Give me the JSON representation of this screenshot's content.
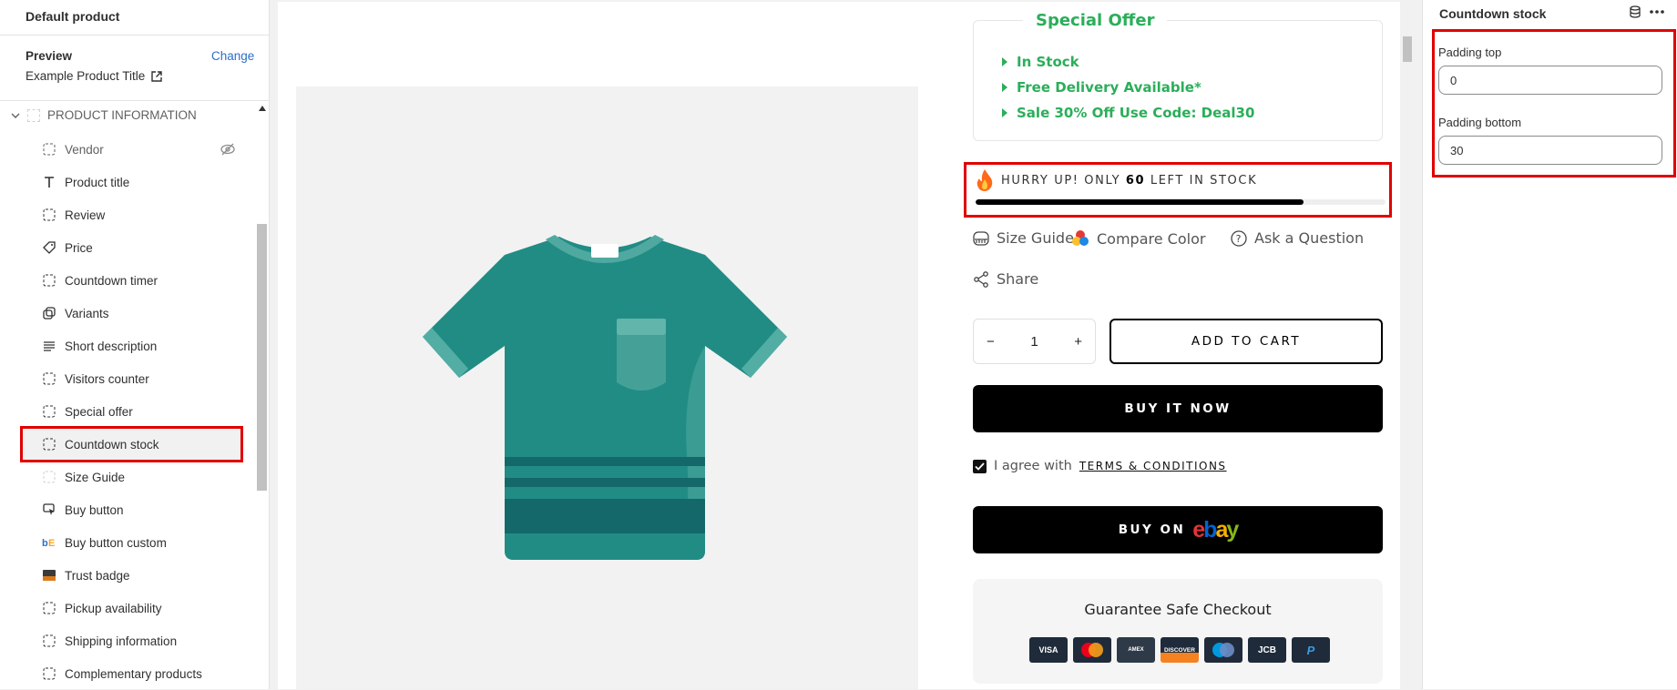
{
  "sidebar": {
    "header": "Default product",
    "preview_label": "Preview",
    "change_label": "Change",
    "preview_product": "Example Product Title",
    "section_title": "PRODUCT INFORMATION",
    "items": [
      {
        "label": "Vendor",
        "icon": "dashed-block-icon",
        "hidden": true
      },
      {
        "label": "Product title",
        "icon": "text-icon"
      },
      {
        "label": "Review",
        "icon": "dashed-block-icon"
      },
      {
        "label": "Price",
        "icon": "tag-icon"
      },
      {
        "label": "Countdown timer",
        "icon": "dashed-block-icon"
      },
      {
        "label": "Variants",
        "icon": "variants-icon"
      },
      {
        "label": "Short description",
        "icon": "paragraph-icon"
      },
      {
        "label": "Visitors counter",
        "icon": "dashed-block-icon"
      },
      {
        "label": "Special offer",
        "icon": "dashed-block-icon"
      },
      {
        "label": "Countdown stock",
        "icon": "dashed-block-icon",
        "selected": true
      },
      {
        "label": "Size Guide",
        "icon": "faded-block-icon"
      },
      {
        "label": "Buy button",
        "icon": "cursor-icon"
      },
      {
        "label": "Buy button custom",
        "icon": "app-icon"
      },
      {
        "label": "Trust badge",
        "icon": "image-icon"
      },
      {
        "label": "Pickup availability",
        "icon": "dashed-block-icon"
      },
      {
        "label": "Shipping information",
        "icon": "dashed-block-icon"
      },
      {
        "label": "Complementary products",
        "icon": "dashed-block-icon"
      }
    ]
  },
  "product": {
    "offer_title": "Special Offer",
    "offer_items": [
      "In Stock",
      "Free Delivery Available*",
      "Sale 30% Off Use Code: Deal30"
    ],
    "hurry_prefix": "HURRY UP! ONLY",
    "hurry_count": "60",
    "hurry_suffix": "LEFT IN STOCK",
    "stock_progress": 0.8,
    "links": {
      "size_guide": "Size Guide",
      "compare_color": "Compare Color",
      "ask_question": "Ask a Question",
      "share": "Share"
    },
    "quantity": "1",
    "minus": "−",
    "plus": "+",
    "add_to_cart": "ADD TO CART",
    "buy_now": "BUY IT NOW",
    "agree_text": "I agree with",
    "terms": "TERMS & CONDITIONS",
    "buy_on": "BUY ON",
    "ebay": {
      "e": "e",
      "b": "b",
      "a": "a",
      "y": "y"
    },
    "guarantee_title": "Guarantee Safe Checkout",
    "cards": [
      "VISA",
      "MC",
      "AMEX",
      "DISCOVER",
      "MAESTRO",
      "JCB",
      "P"
    ]
  },
  "right_panel": {
    "title": "Countdown stock",
    "padding_top_label": "Padding top",
    "padding_top_value": "0",
    "padding_bottom_label": "Padding bottom",
    "padding_bottom_value": "30"
  },
  "colors": {
    "offer_green": "#2bae5a",
    "highlight_red": "#e00000",
    "shirt_teal": "#218c84"
  }
}
